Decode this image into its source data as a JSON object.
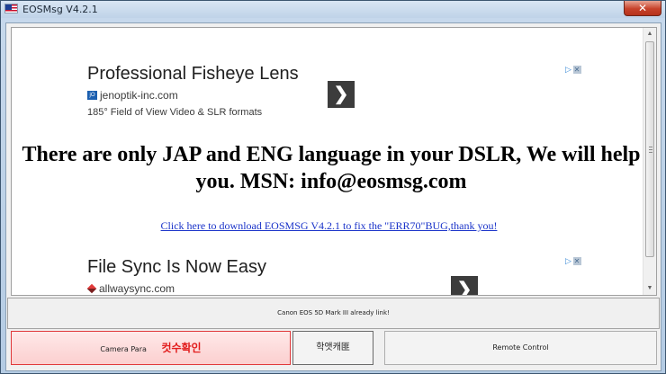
{
  "window": {
    "title": "EOSMsg V4.2.1",
    "close_glyph": "✕",
    "icon": "us-flag-icon"
  },
  "browser": {
    "ads": [
      {
        "title": "Professional Fisheye Lens",
        "favicon_text": "jO",
        "domain": "jenoptik-inc.com",
        "description": "185° Field of View Video & SLR formats",
        "arrow": "❯",
        "choices": "▷"
      },
      {
        "title": "File Sync Is Now Easy",
        "domain": "allwaysync.com",
        "arrow": "❯",
        "choices": "▷"
      }
    ],
    "headline": "There are only JAP and ENG language in your DSLR, We will help you. MSN: info@eosmsg.com",
    "download_link": "Click here to download EOSMSG V4.2.1 to fix the \"ERR70\"BUG,thank you!",
    "scrollbar": {
      "up": "▲",
      "down": "▼"
    }
  },
  "status": {
    "text": "Canon EOS 5D Mark III already link!"
  },
  "buttons": {
    "camera_para": "Camera Para",
    "camera_count": "컷수확인",
    "middle": "학앳캐匪",
    "remote": "Remote Control"
  }
}
